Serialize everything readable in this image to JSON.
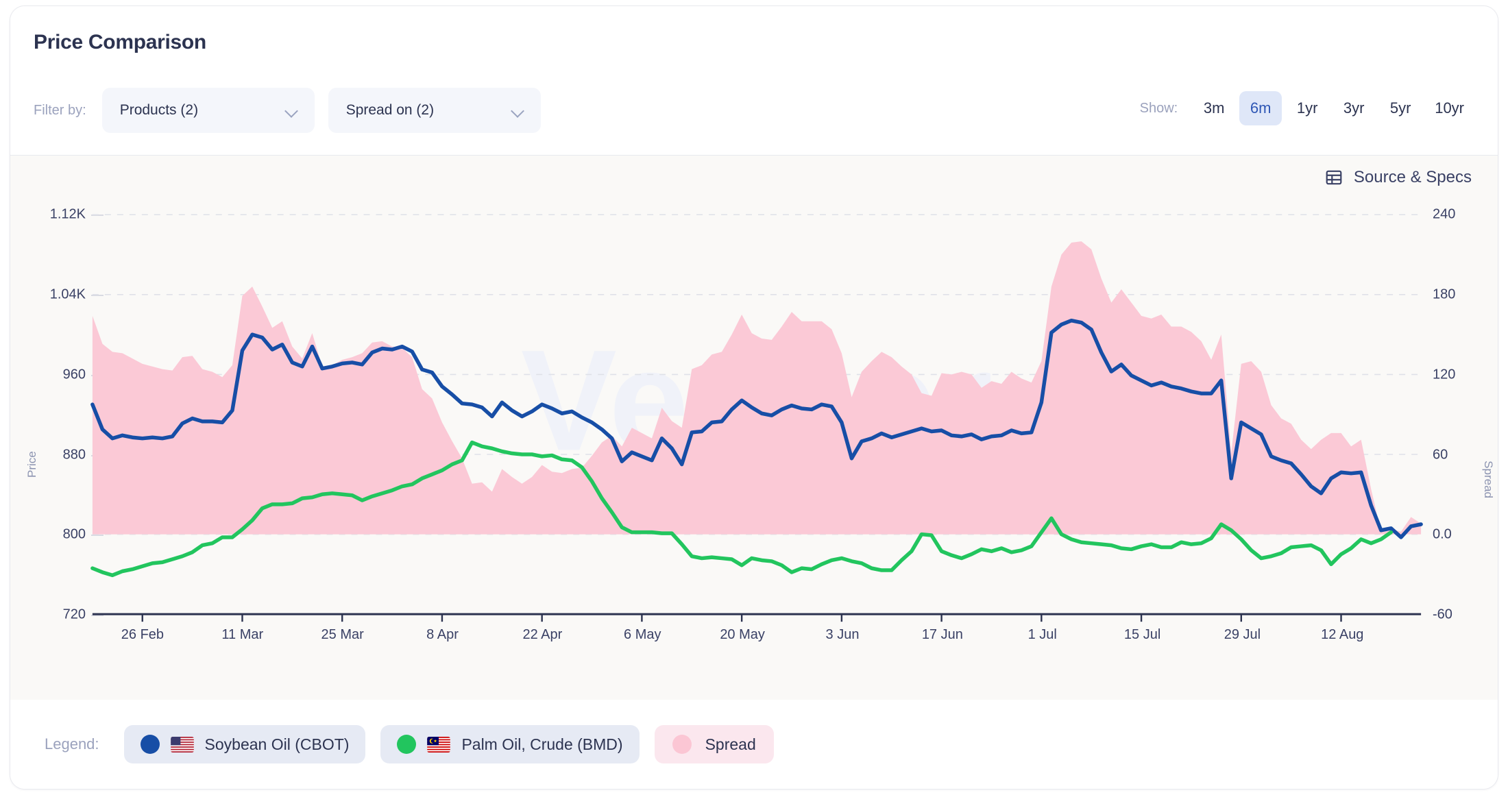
{
  "header": {
    "title": "Price Comparison",
    "filter_label": "Filter by:",
    "dropdowns": [
      {
        "label": "Products (2)",
        "icon": "chevron-down-icon"
      },
      {
        "label": "Spread on (2)",
        "icon": "chevron-down-icon"
      }
    ],
    "show_label": "Show:",
    "ranges": [
      {
        "label": "3m",
        "active": false
      },
      {
        "label": "6m",
        "active": true
      },
      {
        "label": "1yr",
        "active": false
      },
      {
        "label": "3yr",
        "active": false
      },
      {
        "label": "5yr",
        "active": false
      },
      {
        "label": "10yr",
        "active": false
      }
    ]
  },
  "chart_toolbar": {
    "source_specs_label": "Source & Specs",
    "source_specs_icon": "table-icon"
  },
  "legend": {
    "label": "Legend:",
    "items": [
      {
        "name": "Soybean Oil (CBOT)",
        "color": "#174ea6",
        "flag": "us-flag-icon"
      },
      {
        "name": "Palm Oil, Crude (BMD)",
        "color": "#22c55e",
        "flag": "my-flag-icon"
      },
      {
        "name": "Spread",
        "color": "#fbc6d4",
        "flag": null
      }
    ]
  },
  "colors": {
    "soybean": "#174ea6",
    "palm": "#22c55e",
    "spread_fill": "#fbc9d6",
    "grid": "#dfe1e8",
    "axis": "#2c3350",
    "panel_bg": "#faf9f7",
    "accent": "#2f57b5"
  },
  "chart_data": {
    "type": "line",
    "title": "Price Comparison",
    "xlabel": "",
    "ylabel": "Price",
    "y2label": "Spread",
    "ylim": [
      720,
      1160
    ],
    "y2lim": [
      -60,
      270
    ],
    "yticks": [
      720,
      800,
      880,
      960,
      1040,
      1120
    ],
    "ytick_labels": [
      "720",
      "800",
      "880",
      "960",
      "1.04K",
      "1.12K"
    ],
    "y2ticks": [
      -60,
      0,
      60,
      120,
      180,
      240
    ],
    "y2tick_labels": [
      "-60",
      "0.0",
      "60",
      "120",
      "180",
      "240"
    ],
    "grid": true,
    "legend_position": "bottom",
    "x_tick_labels": [
      "26 Feb",
      "11 Mar",
      "25 Mar",
      "8 Apr",
      "22 Apr",
      "6 May",
      "20 May",
      "3 Jun",
      "17 Jun",
      "1 Jul",
      "15 Jul",
      "29 Jul",
      "12 Aug"
    ],
    "x_tick_indices": [
      5,
      15,
      25,
      35,
      45,
      55,
      65,
      75,
      85,
      95,
      105,
      115,
      125
    ],
    "series": [
      {
        "name": "Soybean Oil (CBOT)",
        "axis": "left",
        "color": "#174ea6",
        "values": [
          930,
          905,
          896,
          899,
          897,
          896,
          897,
          896,
          898,
          911,
          916,
          913,
          913,
          912,
          924,
          984,
          1000,
          997,
          985,
          990,
          972,
          968,
          988,
          966,
          968,
          971,
          972,
          970,
          982,
          986,
          985,
          988,
          983,
          965,
          962,
          948,
          940,
          931,
          930,
          927,
          918,
          932,
          924,
          918,
          923,
          930,
          926,
          921,
          923,
          917,
          912,
          905,
          896,
          873,
          882,
          878,
          874,
          896,
          886,
          870,
          902,
          903,
          912,
          913,
          925,
          934,
          927,
          921,
          919,
          925,
          929,
          926,
          925,
          930,
          928,
          912,
          876,
          893,
          896,
          901,
          897,
          900,
          903,
          906,
          903,
          904,
          899,
          898,
          900,
          895,
          898,
          899,
          904,
          901,
          902,
          932,
          1002,
          1010,
          1014,
          1012,
          1005,
          982,
          963,
          970,
          959,
          954,
          949,
          952,
          948,
          946,
          943,
          941,
          941,
          954,
          856,
          912,
          906,
          900,
          878,
          874,
          871,
          860,
          848,
          841,
          856,
          862,
          861,
          862,
          829,
          804,
          806,
          797,
          808,
          810
        ]
      },
      {
        "name": "Palm Oil, Crude (BMD)",
        "axis": "left",
        "color": "#22c55e",
        "values": [
          766,
          762,
          759,
          763,
          765,
          768,
          771,
          772,
          775,
          778,
          782,
          789,
          791,
          797,
          797,
          805,
          814,
          826,
          830,
          830,
          831,
          836,
          837,
          840,
          841,
          840,
          839,
          834,
          838,
          841,
          844,
          848,
          850,
          856,
          860,
          864,
          870,
          874,
          892,
          888,
          886,
          883,
          881,
          880,
          880,
          878,
          879,
          875,
          874,
          867,
          853,
          836,
          822,
          807,
          802,
          802,
          802,
          801,
          801,
          790,
          778,
          776,
          777,
          776,
          775,
          769,
          776,
          774,
          773,
          769,
          762,
          766,
          765,
          770,
          774,
          776,
          773,
          771,
          766,
          764,
          764,
          774,
          783,
          800,
          799,
          783,
          779,
          776,
          780,
          785,
          783,
          786,
          782,
          784,
          788,
          802,
          816,
          800,
          795,
          792,
          791,
          790,
          789,
          786,
          785,
          788,
          790,
          787,
          787,
          792,
          790,
          791,
          796,
          810,
          804,
          795,
          784,
          776,
          778,
          781,
          787,
          788,
          789,
          784,
          770,
          780,
          786,
          795,
          791,
          795,
          802
        ]
      },
      {
        "name": "Spread",
        "axis": "right",
        "color": "#fbc9d6",
        "type": "area",
        "values": [
          164,
          143,
          137,
          136,
          132,
          128,
          126,
          124,
          123,
          133,
          134,
          124,
          122,
          118,
          127,
          179,
          186,
          171,
          155,
          160,
          141,
          132,
          151,
          126,
          127,
          131,
          133,
          136,
          144,
          145,
          141,
          140,
          133,
          109,
          102,
          84,
          70,
          57,
          38,
          39,
          32,
          49,
          43,
          38,
          43,
          52,
          47,
          46,
          49,
          50,
          59,
          69,
          74,
          66,
          80,
          76,
          72,
          95,
          85,
          80,
          124,
          127,
          135,
          137,
          150,
          165,
          151,
          147,
          146,
          156,
          167,
          160,
          160,
          160,
          154,
          136,
          103,
          122,
          130,
          137,
          133,
          126,
          120,
          106,
          104,
          121,
          120,
          122,
          120,
          110,
          115,
          113,
          122,
          117,
          114,
          130,
          186,
          210,
          219,
          220,
          214,
          192,
          174,
          184,
          174,
          164,
          162,
          165,
          156,
          156,
          152,
          145,
          131,
          150,
          61,
          128,
          130,
          122,
          97,
          87,
          83,
          71,
          64,
          71,
          76,
          76,
          66,
          71,
          34,
          2,
          4,
          2,
          13,
          8
        ]
      }
    ]
  }
}
